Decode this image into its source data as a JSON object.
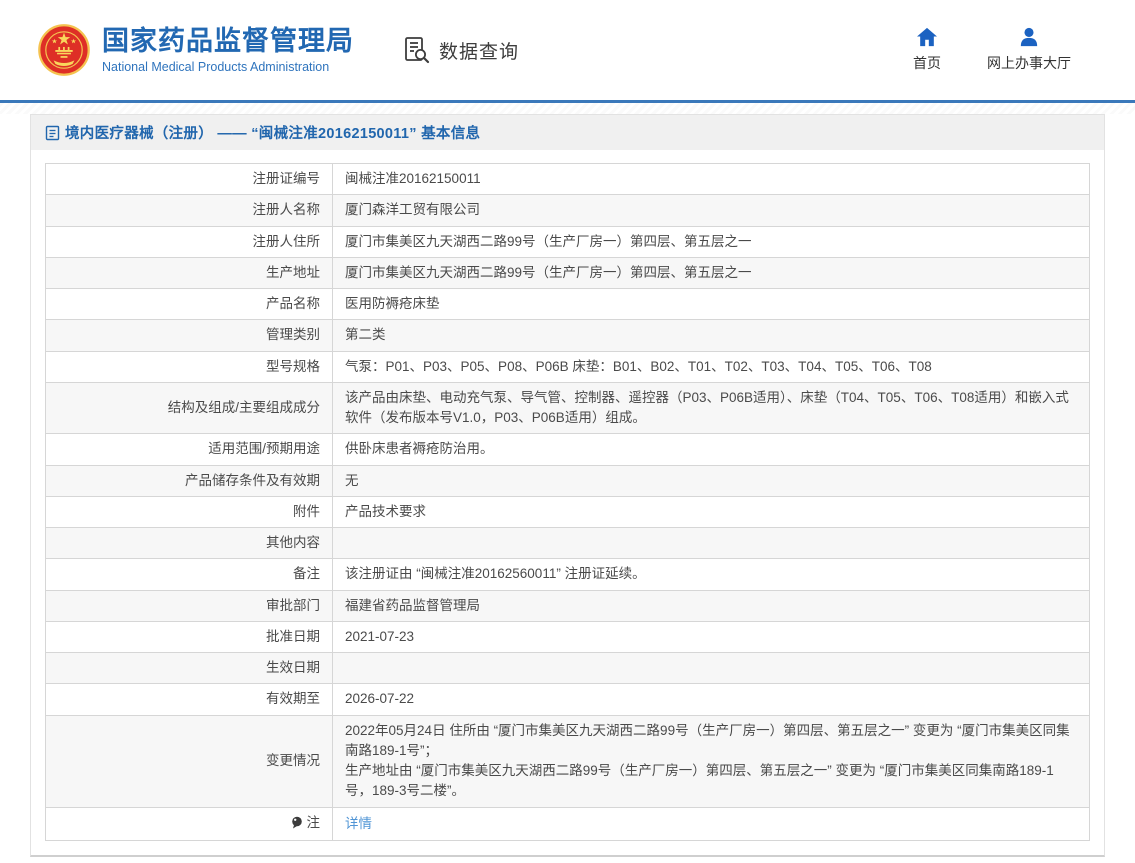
{
  "colors": {
    "accent_blue": "#2268b2",
    "nav_icon_blue": "#1b62c1",
    "link_blue": "#4f94d5",
    "emblem_red": "#de2f26",
    "emblem_gold": "#f5c350",
    "row_alt_bg": "#f7f7f7",
    "table_border": "#d6d6d6",
    "breadcrumb_bg": "#f0f0f0"
  },
  "header": {
    "title_cn": "国家药品监督管理局",
    "title_en": "National Medical Products Administration",
    "section_label": "数据查询",
    "nav": [
      {
        "label": "首页",
        "icon": "home-icon"
      },
      {
        "label": "网上办事大厅",
        "icon": "user-icon"
      }
    ]
  },
  "breadcrumb": {
    "text": "境内医疗器械（注册） —— “闽械注准20162150011” 基本信息"
  },
  "table": {
    "rows": [
      {
        "label": "注册证编号",
        "value": "闽械注准20162150011"
      },
      {
        "label": "注册人名称",
        "value": "厦门森洋工贸有限公司"
      },
      {
        "label": "注册人住所",
        "value": "厦门市集美区九天湖西二路99号（生产厂房一）第四层、第五层之一"
      },
      {
        "label": "生产地址",
        "value": "厦门市集美区九天湖西二路99号（生产厂房一）第四层、第五层之一"
      },
      {
        "label": "产品名称",
        "value": "医用防褥疮床垫"
      },
      {
        "label": "管理类别",
        "value": "第二类"
      },
      {
        "label": "型号规格",
        "value": "气泵：P01、P03、P05、P08、P06B 床垫：B01、B02、T01、T02、T03、T04、T05、T06、T08"
      },
      {
        "label": "结构及组成/主要组成成分",
        "value": "该产品由床垫、电动充气泵、导气管、控制器、遥控器（P03、P06B适用）、床垫（T04、T05、T06、T08适用）和嵌入式软件（发布版本号V1.0，P03、P06B适用）组成。"
      },
      {
        "label": "适用范围/预期用途",
        "value": "供卧床患者褥疮防治用。"
      },
      {
        "label": "产品储存条件及有效期",
        "value": "无"
      },
      {
        "label": "附件",
        "value": "产品技术要求"
      },
      {
        "label": "其他内容",
        "value": ""
      },
      {
        "label": "备注",
        "value": "该注册证由 “闽械注准20162560011” 注册证延续。"
      },
      {
        "label": "审批部门",
        "value": "福建省药品监督管理局"
      },
      {
        "label": "批准日期",
        "value": "2021-07-23"
      },
      {
        "label": "生效日期",
        "value": ""
      },
      {
        "label": "有效期至",
        "value": "2026-07-22"
      },
      {
        "label": "变更情况",
        "value": "2022年05月24日 住所由 “厦门市集美区九天湖西二路99号（生产厂房一）第四层、第五层之一” 变更为 “厦门市集美区同集南路189-1号”；\n生产地址由 “厦门市集美区九天湖西二路99号（生产厂房一）第四层、第五层之一” 变更为 “厦门市集美区同集南路189-1号，189-3号二楼”。"
      },
      {
        "label": "注",
        "label_icon": "note-balloon-icon",
        "link": "详情"
      }
    ]
  }
}
